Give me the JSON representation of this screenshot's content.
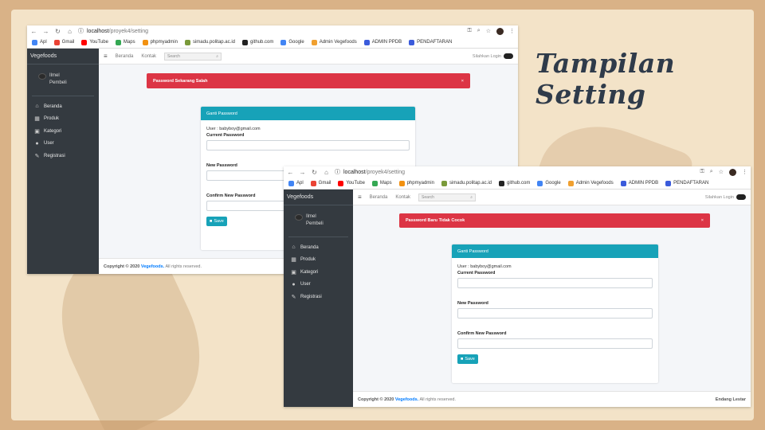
{
  "slide_title": "Tampilan Setting",
  "browser": {
    "url_host": "localhost",
    "url_path": "/proyek4/setting",
    "bookmarks": [
      {
        "label": "Apl",
        "icon": "apps-grid-icon",
        "color": "#4285f4"
      },
      {
        "label": "Gmail",
        "icon": "gmail-icon",
        "color": "#ea4335"
      },
      {
        "label": "YouTube",
        "icon": "youtube-icon",
        "color": "#ff0000"
      },
      {
        "label": "Maps",
        "icon": "maps-pin-icon",
        "color": "#34a853"
      },
      {
        "label": "phpmyadmin",
        "icon": "phpmyadmin-icon",
        "color": "#f29111"
      },
      {
        "label": "simadu.politap.ac.id",
        "icon": "simadu-icon",
        "color": "#7a9a3a"
      },
      {
        "label": "github.com",
        "icon": "github-icon",
        "color": "#222222"
      },
      {
        "label": "Google",
        "icon": "google-icon",
        "color": "#4285f4"
      },
      {
        "label": "Admin Vegefoods",
        "icon": "vegefoods-icon",
        "color": "#f0a030"
      },
      {
        "label": "ADMIN PPDB",
        "icon": "ppdb-icon",
        "color": "#3b5bdb"
      },
      {
        "label": "PENDAFTARAN",
        "icon": "pendaftaran-icon",
        "color": "#3b5bdb"
      }
    ]
  },
  "app": {
    "brand": "Vegefoods",
    "user_name": "Ilmel",
    "user_role": "Pembeli",
    "nav": [
      {
        "label": "Beranda",
        "icon": "home-icon"
      },
      {
        "label": "Produk",
        "icon": "calendar-icon"
      },
      {
        "label": "Kategori",
        "icon": "image-icon"
      },
      {
        "label": "User",
        "icon": "user-icon"
      },
      {
        "label": "Registrasi",
        "icon": "edit-icon"
      }
    ],
    "topnav": {
      "home": "Beranda",
      "contact": "Kontak",
      "search_placeholder": "Search",
      "login": "Silahkan Login"
    },
    "card": {
      "title": "Ganti Password",
      "email": "User : babyboy@gmail.com",
      "current_label": "Current Password",
      "new_label": "New Password",
      "confirm_label": "Confirm New Password",
      "save": "Save"
    },
    "footer": {
      "prefix": "Copyright © 2020",
      "brand": "Vegefoods.",
      "suffix": "All rights reserved.",
      "author": "Endang Lestar"
    }
  },
  "screens": [
    {
      "alert": "Password Sekarang Salah"
    },
    {
      "alert": "Password Baru Tidak Cocok"
    }
  ],
  "colors": {
    "sidebar": "#343a40",
    "accent": "#17a2b8",
    "danger": "#dc3545",
    "title": "#2f3b4a"
  }
}
